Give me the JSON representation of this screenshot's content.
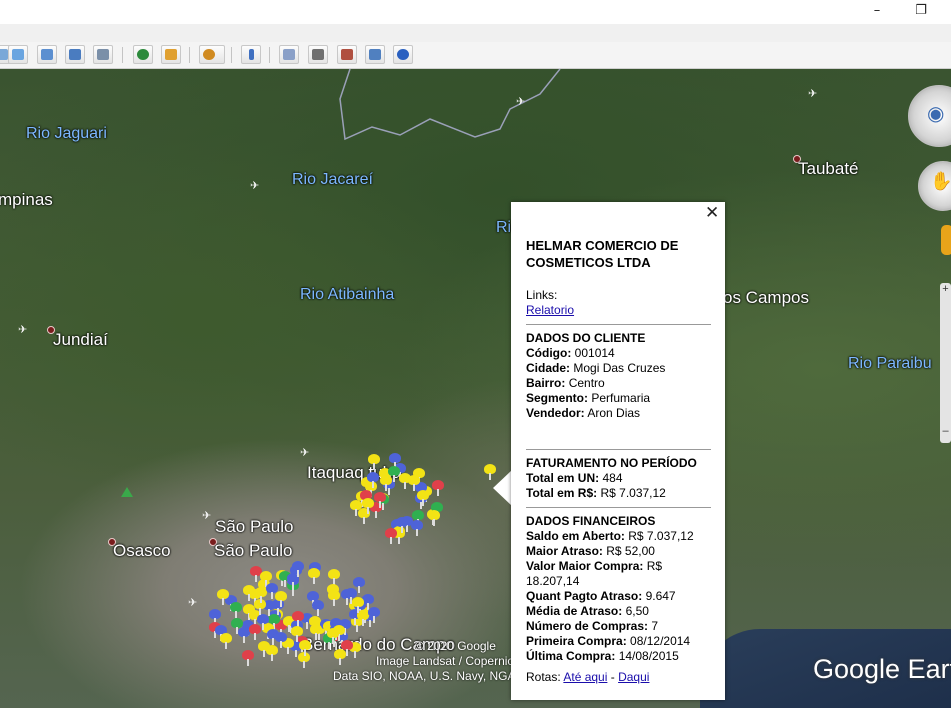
{
  "window": {
    "minimize_glyph": "–",
    "restore_glyph": "❐"
  },
  "toolbar": {
    "buttons": [
      {
        "name": "add-polygon",
        "color": "#6aa5e0"
      },
      {
        "name": "add-path",
        "color": "#5b8fd0"
      },
      {
        "name": "add-image-overlay",
        "color": "#4a7cc0"
      },
      {
        "name": "record-tour",
        "color": "#7a8fa8"
      },
      {
        "name": "historical-imagery",
        "color": "#2c8a3c"
      },
      {
        "name": "sunlight",
        "color": "#e0a030"
      },
      {
        "name": "switch-planets",
        "color": "#d08a20"
      },
      {
        "name": "ruler",
        "color": "#3f6fc0"
      },
      {
        "name": "email",
        "color": "#8aa0c8"
      },
      {
        "name": "print",
        "color": "#707070"
      },
      {
        "name": "save-image",
        "color": "#b05040"
      },
      {
        "name": "view-in-maps",
        "color": "#5080c0"
      },
      {
        "name": "earth-gallery",
        "color": "#2a60c0"
      }
    ]
  },
  "map": {
    "labels": {
      "rio_jaguari": "Rio Jaguari",
      "rio_jacarei": "Rio Jacareí",
      "rio_atibainha": "Rio Atibainha",
      "rio_paraibu": "Rio Paraibu",
      "rio_partial": "Ri",
      "campinas": "mpinas",
      "jundiai": "Jundiaí",
      "taubate": "Taubaté",
      "sjcampos": "os Campos",
      "itaquaquecetuba": "Itaquaq          tuba",
      "sao_paulo_1": "São Paulo",
      "sao_paulo_2": "São Paulo",
      "osasco": "Osasco",
      "sbc": "Bernardo do Campo"
    },
    "attribution": {
      "copyright": "© 2020 Google",
      "image": "Image Landsat / Copernicus",
      "data": "Data SIO, NOAA, U.S. Navy, NGA, GEBCO"
    },
    "logo": "Google Earth",
    "zoom_plus": "+",
    "zoom_minus": "–"
  },
  "popup": {
    "close_glyph": "✕",
    "company": "HELMAR COMERCIO DE COSMETICOS LTDA",
    "links_label": "Links:",
    "report_link": "Relatorio",
    "client_section": "DADOS DO CLIENTE",
    "client": [
      {
        "label": "Código:",
        "value": "001014"
      },
      {
        "label": "Cidade:",
        "value": "Mogi Das Cruzes"
      },
      {
        "label": "Bairro:",
        "value": "Centro"
      },
      {
        "label": "Segmento:",
        "value": "Perfumaria"
      },
      {
        "label": "Vendedor:",
        "value": "Aron Dias"
      }
    ],
    "billing_section": "FATURAMENTO NO PERÍODO",
    "billing": [
      {
        "label": "Total em UN:",
        "value": "484"
      },
      {
        "label": "Total em R$:",
        "value": "R$ 7.037,12"
      }
    ],
    "finance_section": "DADOS FINANCEIROS",
    "finance": [
      {
        "label": "Saldo em Aberto:",
        "value": "R$ 7.037,12"
      },
      {
        "label": "Maior Atraso:",
        "value": "R$ 52,00"
      },
      {
        "label": "Valor Maior Compra:",
        "value": "R$ 18.207,14"
      },
      {
        "label": "Quant Pagto Atraso:",
        "value": "9.647"
      },
      {
        "label": "Média de Atraso:",
        "value": "6,50"
      },
      {
        "label": "Número de Compras:",
        "value": "7"
      },
      {
        "label": "Primeira Compra:",
        "value": "08/12/2014"
      },
      {
        "label": "Última Compra:",
        "value": "14/08/2015"
      }
    ],
    "routes_label": "Rotas:",
    "route_to": "Até aqui",
    "route_sep": "-",
    "route_from": "Daqui"
  }
}
